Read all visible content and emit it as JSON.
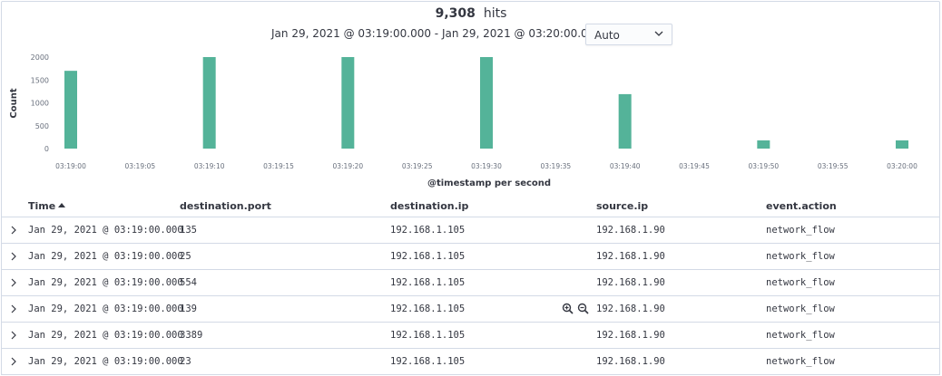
{
  "header": {
    "hits_count": "9,308",
    "hits_label": "hits",
    "time_range": "Jan 29, 2021 @ 03:19:00.000 - Jan 29, 2021 @ 03:20:00.000 —",
    "interval_value": "Auto"
  },
  "chart_data": {
    "type": "bar",
    "categories": [
      "03:19:00",
      "03:19:10",
      "03:19:20",
      "03:19:30",
      "03:19:40",
      "03:19:50",
      "03:20:00"
    ],
    "values": [
      1700,
      2000,
      2000,
      2000,
      1190,
      180,
      180
    ],
    "x_tick_labels": [
      "03:19:00",
      "03:19:05",
      "03:19:10",
      "03:19:15",
      "03:19:20",
      "03:19:25",
      "03:19:30",
      "03:19:35",
      "03:19:40",
      "03:19:45",
      "03:19:50",
      "03:19:55",
      "03:20:00"
    ],
    "y_tick_labels": [
      "2000",
      "1500",
      "1000",
      "500",
      "0"
    ],
    "y_ticks": [
      2000,
      1500,
      1000,
      500,
      0
    ],
    "xlabel": "@timestamp per second",
    "ylabel": "Count",
    "ylim": [
      0,
      2000
    ],
    "bar_color": "#54b399",
    "grid": false
  },
  "table": {
    "columns": [
      "Time",
      "destination.port",
      "destination.ip",
      "source.ip",
      "event.action"
    ],
    "rows": [
      {
        "time": "Jan 29, 2021 @ 03:19:00.000",
        "port": "135",
        "dst": "192.168.1.105",
        "src": "192.168.1.90",
        "action": "network_flow"
      },
      {
        "time": "Jan 29, 2021 @ 03:19:00.000",
        "port": "25",
        "dst": "192.168.1.105",
        "src": "192.168.1.90",
        "action": "network_flow"
      },
      {
        "time": "Jan 29, 2021 @ 03:19:00.000",
        "port": "554",
        "dst": "192.168.1.105",
        "src": "192.168.1.90",
        "action": "network_flow"
      },
      {
        "time": "Jan 29, 2021 @ 03:19:00.000",
        "port": "139",
        "dst": "192.168.1.105",
        "src": "192.168.1.90",
        "action": "network_flow"
      },
      {
        "time": "Jan 29, 2021 @ 03:19:00.000",
        "port": "3389",
        "dst": "192.168.1.105",
        "src": "192.168.1.90",
        "action": "network_flow"
      },
      {
        "time": "Jan 29, 2021 @ 03:19:00.000",
        "port": "23",
        "dst": "192.168.1.105",
        "src": "192.168.1.90",
        "action": "network_flow"
      }
    ]
  },
  "icons": {
    "expand": "arrow-right-icon",
    "sort": "sort-ascending-icon",
    "zoom_in": "magnify-plus-icon",
    "zoom_out": "magnify-minus-icon",
    "select_chevron": "chevron-down-icon"
  }
}
